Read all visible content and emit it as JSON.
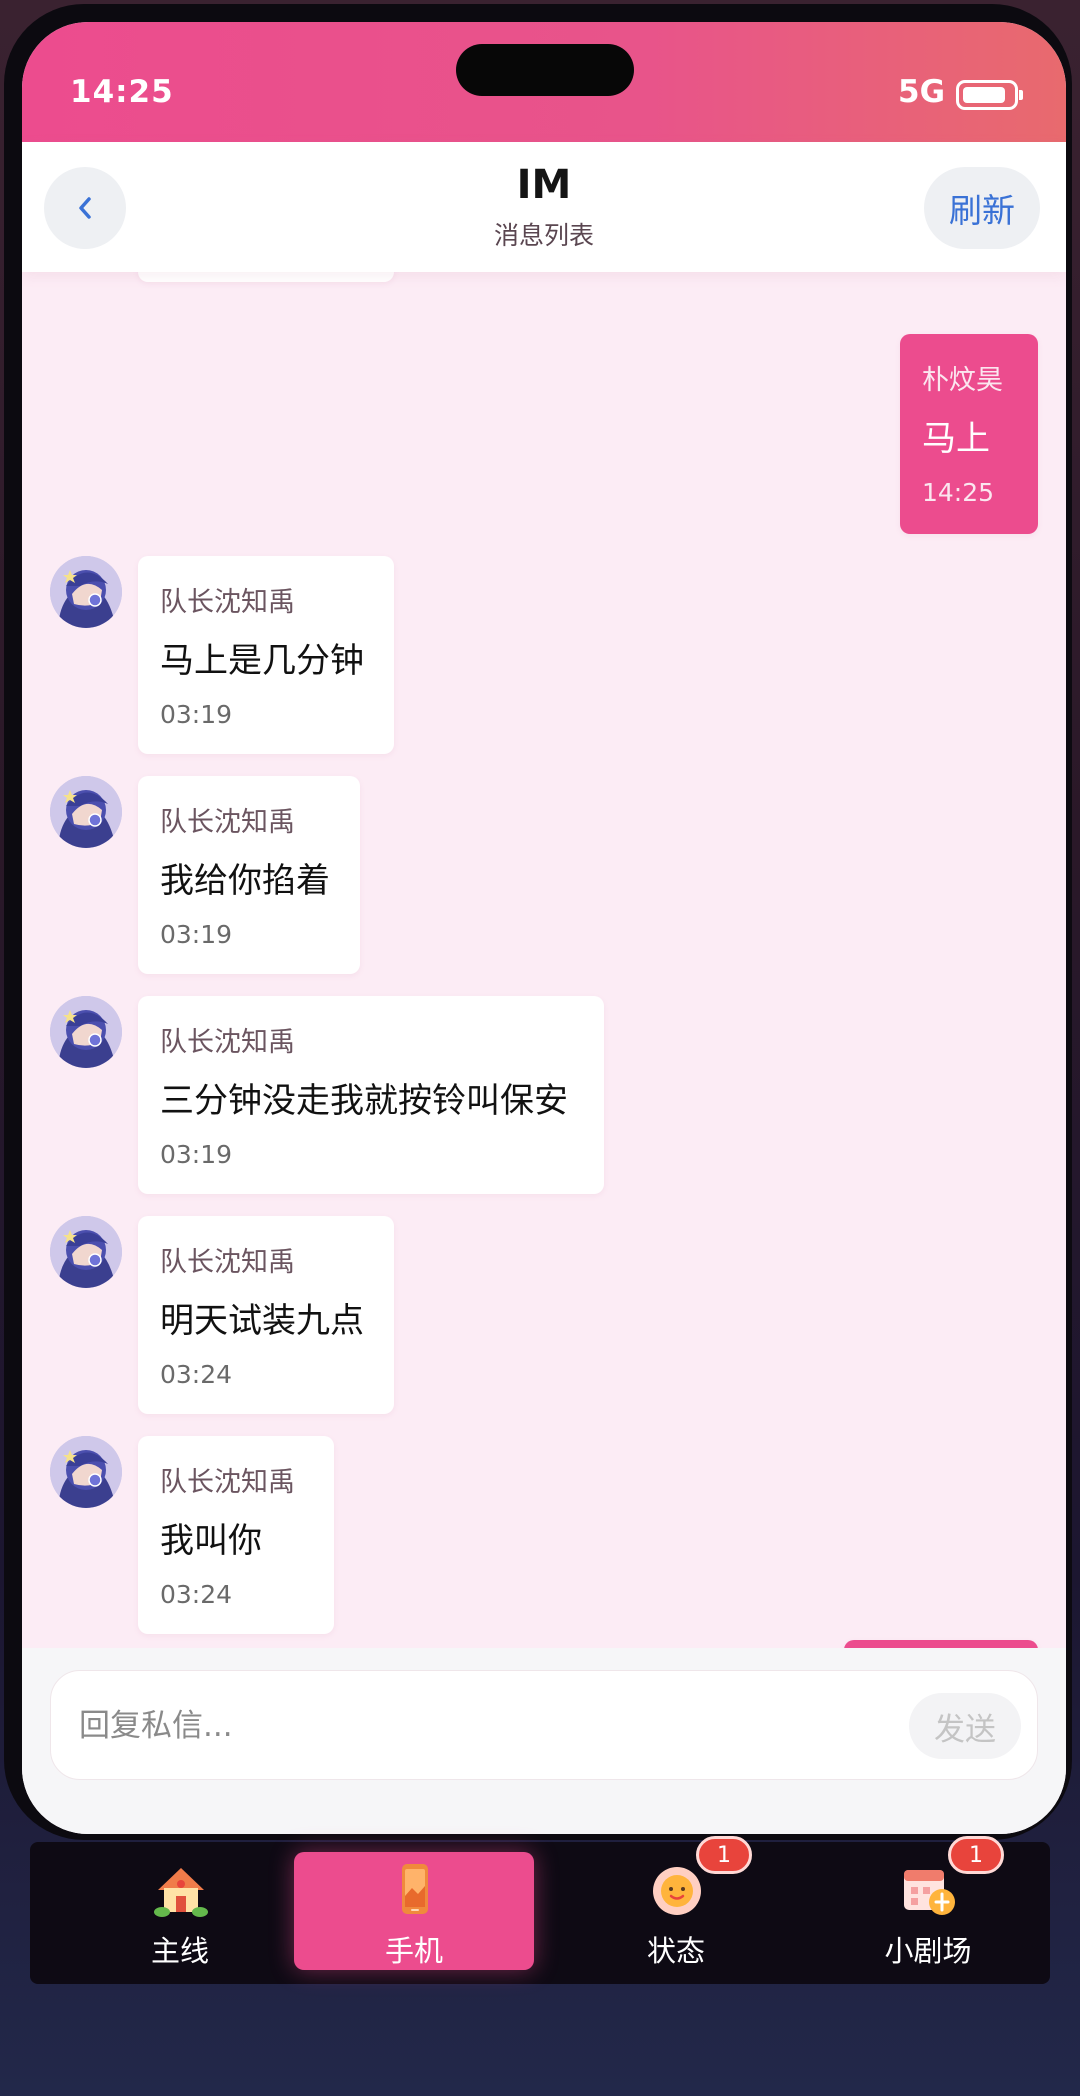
{
  "status_bar": {
    "time": "14:25",
    "network": "5G"
  },
  "header": {
    "title": "IM",
    "subtitle": "消息列表",
    "refresh_label": "刷新"
  },
  "messages": [
    {
      "direction": "outgoing",
      "sender": "朴炆昊",
      "text": "马上",
      "time": "14:25"
    },
    {
      "direction": "incoming",
      "sender": "队长沈知禹",
      "text": "马上是几分钟",
      "time": "03:19"
    },
    {
      "direction": "incoming",
      "sender": "队长沈知禹",
      "text": "我给你掐着",
      "time": "03:19"
    },
    {
      "direction": "incoming",
      "sender": "队长沈知禹",
      "text": "三分钟没走我就按铃叫保安",
      "time": "03:19"
    },
    {
      "direction": "incoming",
      "sender": "队长沈知禹",
      "text": "明天试装九点",
      "time": "03:24"
    },
    {
      "direction": "incoming",
      "sender": "队长沈知禹",
      "text": "我叫你",
      "time": "03:24"
    }
  ],
  "composer": {
    "placeholder": "回复私信...",
    "value": "",
    "send_label": "发送"
  },
  "tabs": [
    {
      "label": "主线",
      "icon": "house-icon",
      "active": false,
      "badge": ""
    },
    {
      "label": "手机",
      "icon": "phone-icon",
      "active": true,
      "badge": ""
    },
    {
      "label": "状态",
      "icon": "sun-face-icon",
      "active": false,
      "badge": "1"
    },
    {
      "label": "小剧场",
      "icon": "calendar-icon",
      "active": false,
      "badge": "1"
    }
  ],
  "colors": {
    "accent": "#ec4c8e",
    "chat_bg": "#fcecf5",
    "link": "#3a72d6",
    "badge": "#e8443c"
  }
}
